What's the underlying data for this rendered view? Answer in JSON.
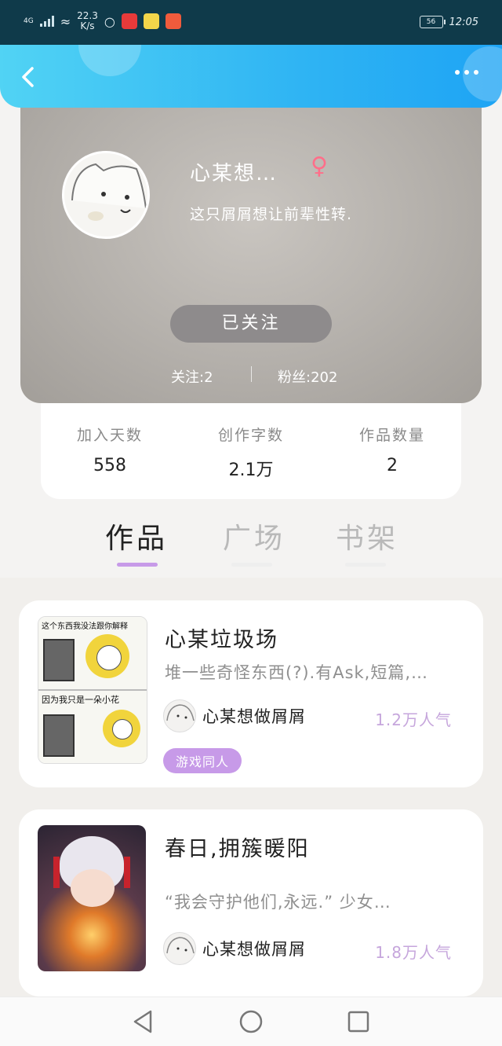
{
  "status_bar": {
    "signal": "4G",
    "speed_value": "22.3",
    "speed_unit": "K/s",
    "battery": "56",
    "time": "12:05"
  },
  "nav": {
    "back_icon": "chevron-left-icon",
    "more_icon": "more-horizontal-icon"
  },
  "profile": {
    "nickname": "心某想…",
    "gender_symbol": "♀",
    "bio": "这只屑屑想让前辈性转.",
    "follow_button": "已关注",
    "following": "关注:2",
    "fans": "粉丝:202"
  },
  "stats": [
    {
      "label": "加入天数",
      "value": "558"
    },
    {
      "label": "创作字数",
      "value": "2.1万"
    },
    {
      "label": "作品数量",
      "value": "2"
    }
  ],
  "tabs": [
    {
      "label": "作品",
      "active": true
    },
    {
      "label": "广场",
      "active": false
    },
    {
      "label": "书架",
      "active": false
    }
  ],
  "colors": {
    "accent": "#c79ae8",
    "nav_blue": "#2fb4f3",
    "tag_purple": "#c79ae8",
    "popularity": "#c6a6dc"
  },
  "books": [
    {
      "title": "心某垃圾场",
      "desc": "堆一些奇怪东西(?).有Ask,短篇,…",
      "cover_text_top": "这个东西我没法跟你解释",
      "cover_text_bottom": "因为我只是一朵小花",
      "author": "心某想做屑屑",
      "popularity": "1.2万人气",
      "tag": "游戏同人"
    },
    {
      "title": "春日,拥簇暖阳",
      "desc": "“我会守护他们,永远.” 少女…",
      "author": "心某想做屑屑",
      "popularity": "1.8万人气"
    }
  ]
}
